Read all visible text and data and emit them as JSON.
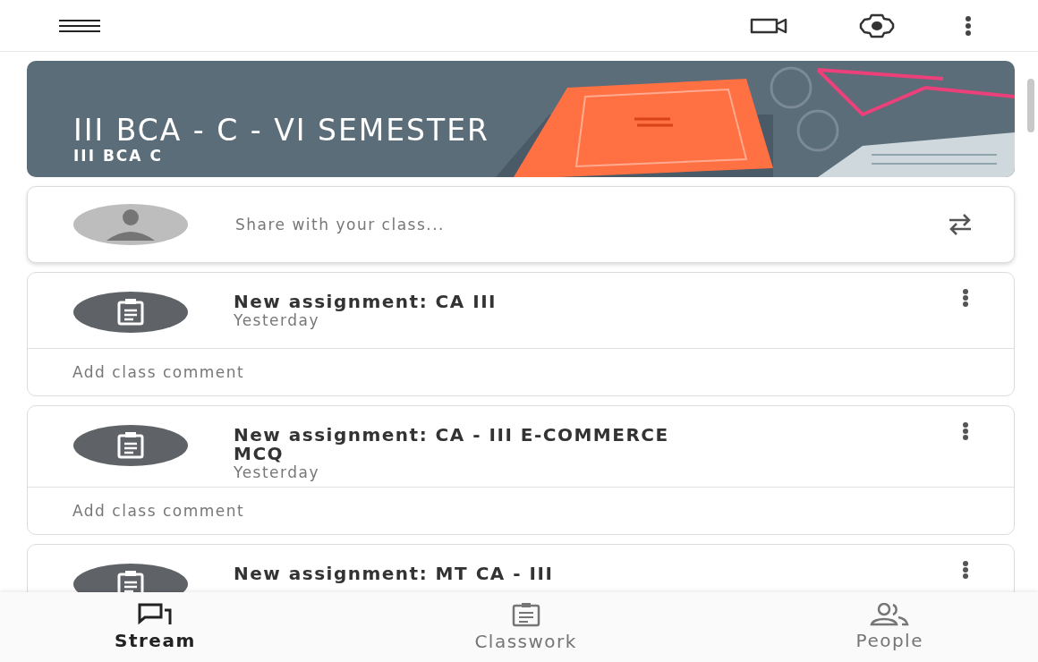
{
  "banner": {
    "title": "III BCA - C - VI SEMESTER",
    "subtitle": "III BCA C"
  },
  "share": {
    "placeholder": "Share with your class..."
  },
  "posts": [
    {
      "title": "New assignment: CA III",
      "date": "Yesterday",
      "comment_placeholder": "Add class comment"
    },
    {
      "title": "New assignment: CA - III E-COMMERCE MCQ",
      "date": "Yesterday",
      "comment_placeholder": "Add class comment"
    },
    {
      "title": "New assignment: MT CA - III"
    }
  ],
  "bottom_nav": [
    {
      "kind": "stream",
      "label": "Stream",
      "selected": true
    },
    {
      "kind": "classwork",
      "label": "Classwork",
      "selected": false
    },
    {
      "kind": "people",
      "label": "People",
      "selected": false
    }
  ]
}
